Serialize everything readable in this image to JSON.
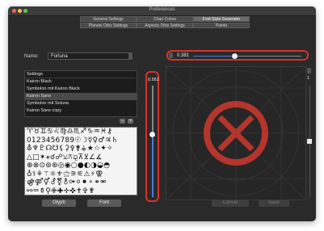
{
  "window": {
    "title": "Preferences"
  },
  "tabs": [
    {
      "label": "General Settings"
    },
    {
      "label": "Chart Colors"
    },
    {
      "label": "Font Style Generator"
    },
    {
      "label": "Planets Orbs Settings"
    },
    {
      "label": "Aspects Orbs Settings"
    },
    {
      "label": "Points"
    }
  ],
  "active_tab": "Font Style Generator",
  "name_field": {
    "label": "Name:",
    "value": "Fortuna"
  },
  "settings_list": {
    "header": "Settings",
    "items": [
      {
        "label": "Kairon Black"
      },
      {
        "label": "Symbolon mit Kairon Black"
      },
      {
        "label": "Kairon Sans"
      },
      {
        "label": "Symbolon mit Soluna"
      },
      {
        "label": "Kairon Sans copy"
      }
    ],
    "selected": "Kairon Sans",
    "remove_label": "−",
    "add_label": "+"
  },
  "glyph_grid": {
    "rows": [
      "♈♉♊♋♌♍♎♏♐♑♒♓⚷",
      "0123456789☉☽☿♀♂♃♄",
      "⛢♆♇☊☋⚸⚳⚴⚵⚶★☆✦✧",
      "△□✶⚹☌☍⚺⚻⚼⊼⊻∠∡",
      "⊕⊗⊙⊚⊛◎◉○●◐◑◒◓",
      "♁⚕⚘⚚⚛⚜⚝⚞⚟⚠⚡⚢",
      "⚣⚤⚥⚦⚧⚨⚩⚪⚫⚬⚭⚮",
      "⚯⚰⚱⚲✙✚✛✜✝✞✟"
    ]
  },
  "buttons": {
    "glyph": "Glyph",
    "font": "Font",
    "cancel": "Cancel",
    "save": "Save"
  },
  "h_slider": {
    "value": "0.381",
    "fraction": 0.381,
    "highlight_color": "#d9302b"
  },
  "v_slider": {
    "value": "0.562",
    "fraction": 0.562,
    "highlight_color": "#d9302b"
  },
  "right_slider": {
    "value": "1",
    "fraction": 0.5
  },
  "preview": {
    "glyph_color": "#b5352c",
    "glyph": "circled-x-icon"
  }
}
